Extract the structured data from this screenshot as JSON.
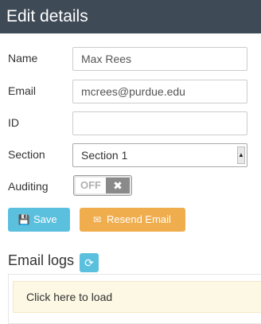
{
  "header": {
    "title": "Edit details"
  },
  "form": {
    "name_label": "Name",
    "name_value": "Max Rees",
    "email_label": "Email",
    "email_value": "mcrees@purdue.edu",
    "id_label": "ID",
    "id_value": "",
    "section_label": "Section",
    "section_value": "Section 1",
    "auditing_label": "Auditing",
    "auditing_state": "OFF",
    "auditing_knob": "✖"
  },
  "buttons": {
    "save_label": "Save",
    "save_icon": "💾",
    "resend_label": "Resend Email",
    "resend_icon": "✉"
  },
  "logs": {
    "title": "Email logs",
    "refresh_icon": "⟳",
    "load_text": "Click here to load"
  },
  "colors": {
    "header_bg": "#3f4a57",
    "save": "#5bc0de",
    "resend": "#f0ad4e",
    "load_bg": "#fcf8e3"
  }
}
